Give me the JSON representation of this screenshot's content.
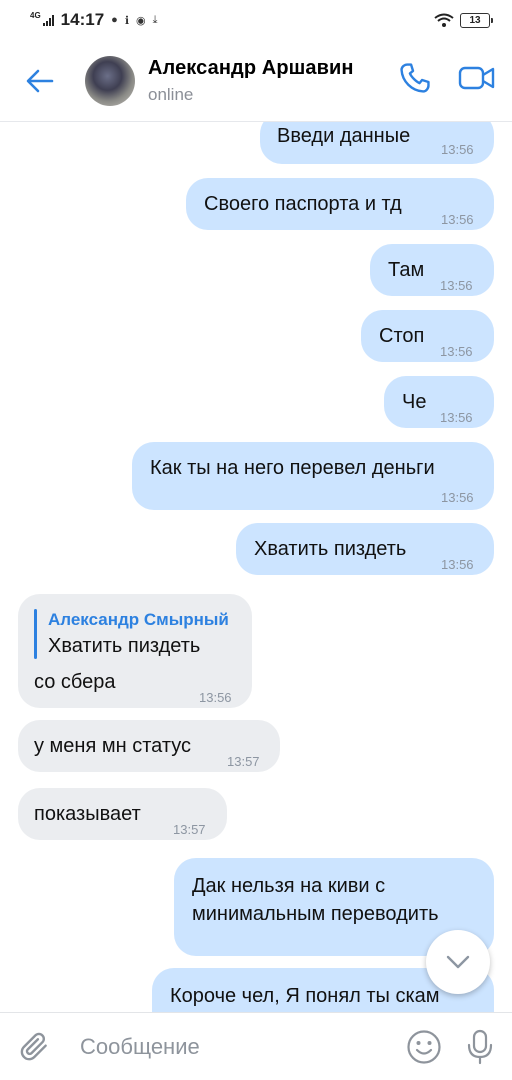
{
  "status_bar": {
    "network": "4G",
    "time": "14:17",
    "battery": "13"
  },
  "header": {
    "contact_name": "Александр Аршавин",
    "contact_status": "online"
  },
  "messages": [
    {
      "direction": "out",
      "text": "Введи данные",
      "time": "13:56"
    },
    {
      "direction": "out",
      "text": "Своего паспорта и тд",
      "time": "13:56"
    },
    {
      "direction": "out",
      "text": "Там",
      "time": "13:56"
    },
    {
      "direction": "out",
      "text": "Стоп",
      "time": "13:56"
    },
    {
      "direction": "out",
      "text": "Че",
      "time": "13:56"
    },
    {
      "direction": "out",
      "text": "Как ты на него перевел деньги",
      "time": "13:56"
    },
    {
      "direction": "out",
      "text": "Хватить пиздеть",
      "time": "13:56"
    },
    {
      "direction": "in",
      "reply_author": "Александр Смырный",
      "reply_text": "Хватить пиздеть",
      "text": "со сбера",
      "time": "13:56"
    },
    {
      "direction": "in",
      "text": "у меня мн статус",
      "time": "13:57"
    },
    {
      "direction": "in",
      "text": "показывает",
      "time": "13:57"
    },
    {
      "direction": "out",
      "text_line1": "Дак нельзя на киви с",
      "text_line2": "минимальным переводить"
    },
    {
      "direction": "out",
      "text": "Короче чел, Я понял ты скам"
    }
  ],
  "input": {
    "placeholder": "Сообщение"
  },
  "colors": {
    "accent": "#2d81e0",
    "outgoing_bubble": "#cce4ff",
    "incoming_bubble": "#ebedf0"
  },
  "icons": [
    "back-arrow-icon",
    "phone-icon",
    "video-camera-icon",
    "chevron-down-icon",
    "paperclip-icon",
    "emoji-icon",
    "microphone-icon"
  ]
}
